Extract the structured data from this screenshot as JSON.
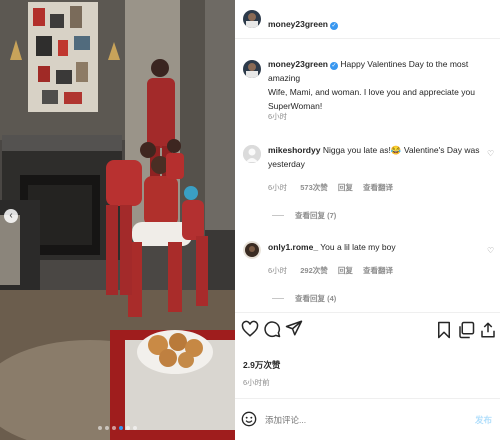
{
  "post": {
    "author": "money23green",
    "caption": "Happy Valentines Day to the most amazing Wife, Mami, and woman. I love you and appreciate you SuperWoman!",
    "caption_lines": [
      "Happy Valentines Day to the most amazing",
      "Wife, Mami, and woman. I love you and appreciate you",
      "SuperWoman!"
    ],
    "caption_time": "6小时",
    "likes": "2.9万次赞",
    "time": "6小时前"
  },
  "comments": [
    {
      "user": "mikeshordyy",
      "text_line1": "Nigga you late as!😂 Valentine's Day was",
      "text_line2": "yesterday",
      "time": "6小时",
      "likes": "573次赞",
      "reply": "回复",
      "translate": "查看翻译",
      "view_replies": "查看回复 (7)"
    },
    {
      "user": "only1.rome_",
      "text": "You a lil late my boy",
      "time": "6小时",
      "likes": "292次赞",
      "reply": "回复",
      "translate": "查看翻译",
      "view_replies": "查看回复 (4)"
    }
  ],
  "composer": {
    "placeholder": "添加评论...",
    "post_label": "发布"
  },
  "icons": {
    "like": "heart-icon",
    "comment": "comment-icon",
    "share": "send-icon",
    "save": "bookmark-icon",
    "emoji": "emoji-icon",
    "prev": "chevron-left-icon"
  },
  "colors": {
    "verified": "#3897f0",
    "meta_text": "#8e8e8e",
    "post_button": "#b2dffc"
  }
}
